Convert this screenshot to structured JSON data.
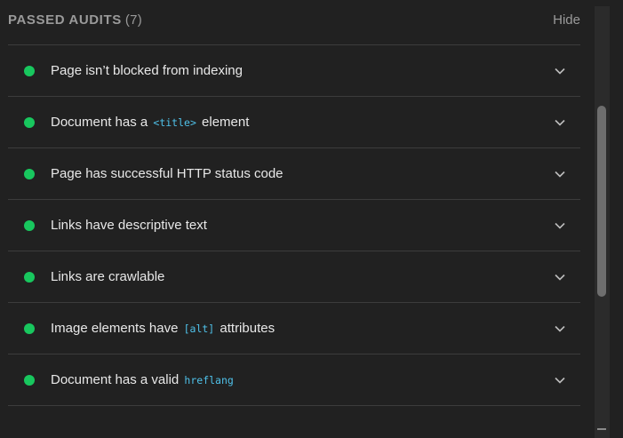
{
  "header": {
    "title": "PASSED AUDITS",
    "count": "(7)",
    "hide_label": "Hide"
  },
  "audits": [
    {
      "pre": "Page isn’t blocked from indexing",
      "code": "",
      "post": ""
    },
    {
      "pre": "Document has a ",
      "code": "<title>",
      "post": " element"
    },
    {
      "pre": "Page has successful HTTP status code",
      "code": "",
      "post": ""
    },
    {
      "pre": "Links have descriptive text",
      "code": "",
      "post": ""
    },
    {
      "pre": "Links are crawlable",
      "code": "",
      "post": ""
    },
    {
      "pre": "Image elements have ",
      "code": "[alt]",
      "post": " attributes"
    },
    {
      "pre": "Document has a valid ",
      "code": "hreflang",
      "post": ""
    }
  ],
  "colors": {
    "pass": "#18c75e",
    "code": "#4fc1e9",
    "background": "#212121"
  },
  "icons": {
    "status": "pass-dot-icon",
    "expand": "chevron-down-icon"
  }
}
